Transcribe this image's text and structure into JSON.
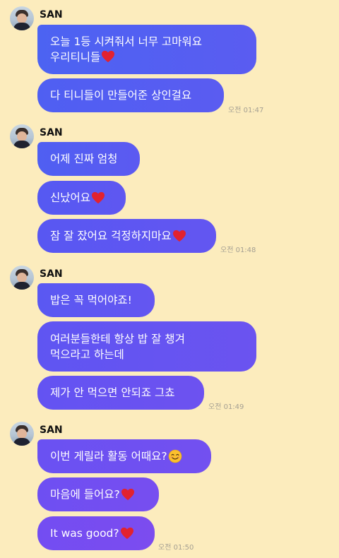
{
  "sender": "SAN",
  "colors": {
    "background": "#fcecbd",
    "bubble_blue": "#4f5ff2",
    "bubble_purple": "#7a4ef0",
    "time_text": "#a49f92"
  },
  "groups": [
    {
      "sender": "SAN",
      "messages": [
        {
          "lines": [
            "오늘 1등 시켜줘서 너무 고마워요",
            "우리티니들"
          ],
          "heart": true
        },
        {
          "lines": [
            "다 티니들이 만들어준 상인걸요"
          ]
        }
      ],
      "time": "오전 01:47"
    },
    {
      "sender": "SAN",
      "messages": [
        {
          "lines": [
            "어제 진짜 엄청"
          ]
        },
        {
          "lines": [
            "신났어요"
          ],
          "heart": true
        },
        {
          "lines": [
            "잠 잘 잤어요 걱정하지마요"
          ],
          "heart": true
        }
      ],
      "time": "오전 01:48"
    },
    {
      "sender": "SAN",
      "messages": [
        {
          "lines": [
            "밥은 꼭 먹어야죠!"
          ]
        },
        {
          "lines": [
            "여러분들한테 항상 밥 잘 챙겨",
            "먹으라고 하는데"
          ]
        },
        {
          "lines": [
            "제가 안 먹으면 안되죠 그쵸"
          ]
        }
      ],
      "time": "오전 01:49"
    },
    {
      "sender": "SAN",
      "messages": [
        {
          "lines": [
            "이번 게릴라 활동 어때요?"
          ],
          "smile": true
        },
        {
          "lines": [
            "마음에 들어요?"
          ],
          "heart": true
        },
        {
          "lines": [
            "It was good?"
          ],
          "heart": true
        }
      ],
      "time": "오전 01:50"
    }
  ]
}
